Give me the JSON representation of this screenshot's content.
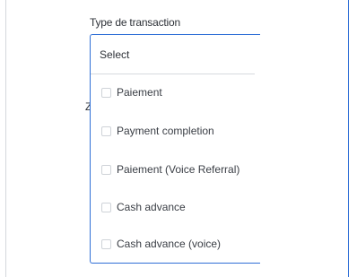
{
  "field": {
    "label": "Type de transaction",
    "select_text": "Select"
  },
  "background_fragment": "Z",
  "options": [
    {
      "label": "Paiement",
      "checked": false
    },
    {
      "label": "Payment completion",
      "checked": false
    },
    {
      "label": "Paiement (Voice Referral)",
      "checked": false
    },
    {
      "label": "Cash advance",
      "checked": false
    },
    {
      "label": "Cash advance (voice)",
      "checked": false
    }
  ],
  "colors": {
    "accent": "#2f6fd6",
    "divider": "#d7dadf",
    "checkbox_border": "#cfd3d8"
  }
}
